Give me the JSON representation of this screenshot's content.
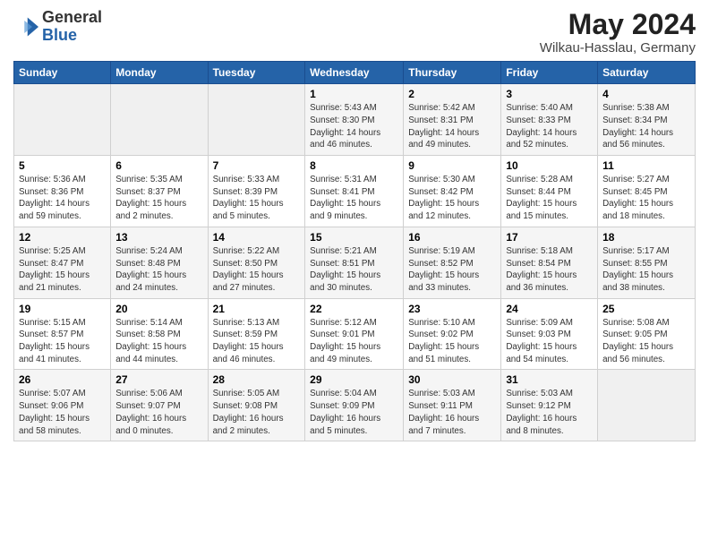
{
  "header": {
    "logo_general": "General",
    "logo_blue": "Blue",
    "main_title": "May 2024",
    "subtitle": "Wilkau-Hasslau, Germany"
  },
  "weekdays": [
    "Sunday",
    "Monday",
    "Tuesday",
    "Wednesday",
    "Thursday",
    "Friday",
    "Saturday"
  ],
  "weeks": [
    [
      {
        "day": "",
        "empty": true
      },
      {
        "day": "",
        "empty": true
      },
      {
        "day": "",
        "empty": true
      },
      {
        "day": "1",
        "info": "Sunrise: 5:43 AM\nSunset: 8:30 PM\nDaylight: 14 hours\nand 46 minutes."
      },
      {
        "day": "2",
        "info": "Sunrise: 5:42 AM\nSunset: 8:31 PM\nDaylight: 14 hours\nand 49 minutes."
      },
      {
        "day": "3",
        "info": "Sunrise: 5:40 AM\nSunset: 8:33 PM\nDaylight: 14 hours\nand 52 minutes."
      },
      {
        "day": "4",
        "info": "Sunrise: 5:38 AM\nSunset: 8:34 PM\nDaylight: 14 hours\nand 56 minutes."
      }
    ],
    [
      {
        "day": "5",
        "info": "Sunrise: 5:36 AM\nSunset: 8:36 PM\nDaylight: 14 hours\nand 59 minutes."
      },
      {
        "day": "6",
        "info": "Sunrise: 5:35 AM\nSunset: 8:37 PM\nDaylight: 15 hours\nand 2 minutes."
      },
      {
        "day": "7",
        "info": "Sunrise: 5:33 AM\nSunset: 8:39 PM\nDaylight: 15 hours\nand 5 minutes."
      },
      {
        "day": "8",
        "info": "Sunrise: 5:31 AM\nSunset: 8:41 PM\nDaylight: 15 hours\nand 9 minutes."
      },
      {
        "day": "9",
        "info": "Sunrise: 5:30 AM\nSunset: 8:42 PM\nDaylight: 15 hours\nand 12 minutes."
      },
      {
        "day": "10",
        "info": "Sunrise: 5:28 AM\nSunset: 8:44 PM\nDaylight: 15 hours\nand 15 minutes."
      },
      {
        "day": "11",
        "info": "Sunrise: 5:27 AM\nSunset: 8:45 PM\nDaylight: 15 hours\nand 18 minutes."
      }
    ],
    [
      {
        "day": "12",
        "info": "Sunrise: 5:25 AM\nSunset: 8:47 PM\nDaylight: 15 hours\nand 21 minutes."
      },
      {
        "day": "13",
        "info": "Sunrise: 5:24 AM\nSunset: 8:48 PM\nDaylight: 15 hours\nand 24 minutes."
      },
      {
        "day": "14",
        "info": "Sunrise: 5:22 AM\nSunset: 8:50 PM\nDaylight: 15 hours\nand 27 minutes."
      },
      {
        "day": "15",
        "info": "Sunrise: 5:21 AM\nSunset: 8:51 PM\nDaylight: 15 hours\nand 30 minutes."
      },
      {
        "day": "16",
        "info": "Sunrise: 5:19 AM\nSunset: 8:52 PM\nDaylight: 15 hours\nand 33 minutes."
      },
      {
        "day": "17",
        "info": "Sunrise: 5:18 AM\nSunset: 8:54 PM\nDaylight: 15 hours\nand 36 minutes."
      },
      {
        "day": "18",
        "info": "Sunrise: 5:17 AM\nSunset: 8:55 PM\nDaylight: 15 hours\nand 38 minutes."
      }
    ],
    [
      {
        "day": "19",
        "info": "Sunrise: 5:15 AM\nSunset: 8:57 PM\nDaylight: 15 hours\nand 41 minutes."
      },
      {
        "day": "20",
        "info": "Sunrise: 5:14 AM\nSunset: 8:58 PM\nDaylight: 15 hours\nand 44 minutes."
      },
      {
        "day": "21",
        "info": "Sunrise: 5:13 AM\nSunset: 8:59 PM\nDaylight: 15 hours\nand 46 minutes."
      },
      {
        "day": "22",
        "info": "Sunrise: 5:12 AM\nSunset: 9:01 PM\nDaylight: 15 hours\nand 49 minutes."
      },
      {
        "day": "23",
        "info": "Sunrise: 5:10 AM\nSunset: 9:02 PM\nDaylight: 15 hours\nand 51 minutes."
      },
      {
        "day": "24",
        "info": "Sunrise: 5:09 AM\nSunset: 9:03 PM\nDaylight: 15 hours\nand 54 minutes."
      },
      {
        "day": "25",
        "info": "Sunrise: 5:08 AM\nSunset: 9:05 PM\nDaylight: 15 hours\nand 56 minutes."
      }
    ],
    [
      {
        "day": "26",
        "info": "Sunrise: 5:07 AM\nSunset: 9:06 PM\nDaylight: 15 hours\nand 58 minutes."
      },
      {
        "day": "27",
        "info": "Sunrise: 5:06 AM\nSunset: 9:07 PM\nDaylight: 16 hours\nand 0 minutes."
      },
      {
        "day": "28",
        "info": "Sunrise: 5:05 AM\nSunset: 9:08 PM\nDaylight: 16 hours\nand 2 minutes."
      },
      {
        "day": "29",
        "info": "Sunrise: 5:04 AM\nSunset: 9:09 PM\nDaylight: 16 hours\nand 5 minutes."
      },
      {
        "day": "30",
        "info": "Sunrise: 5:03 AM\nSunset: 9:11 PM\nDaylight: 16 hours\nand 7 minutes."
      },
      {
        "day": "31",
        "info": "Sunrise: 5:03 AM\nSunset: 9:12 PM\nDaylight: 16 hours\nand 8 minutes."
      },
      {
        "day": "",
        "empty": true
      }
    ]
  ]
}
